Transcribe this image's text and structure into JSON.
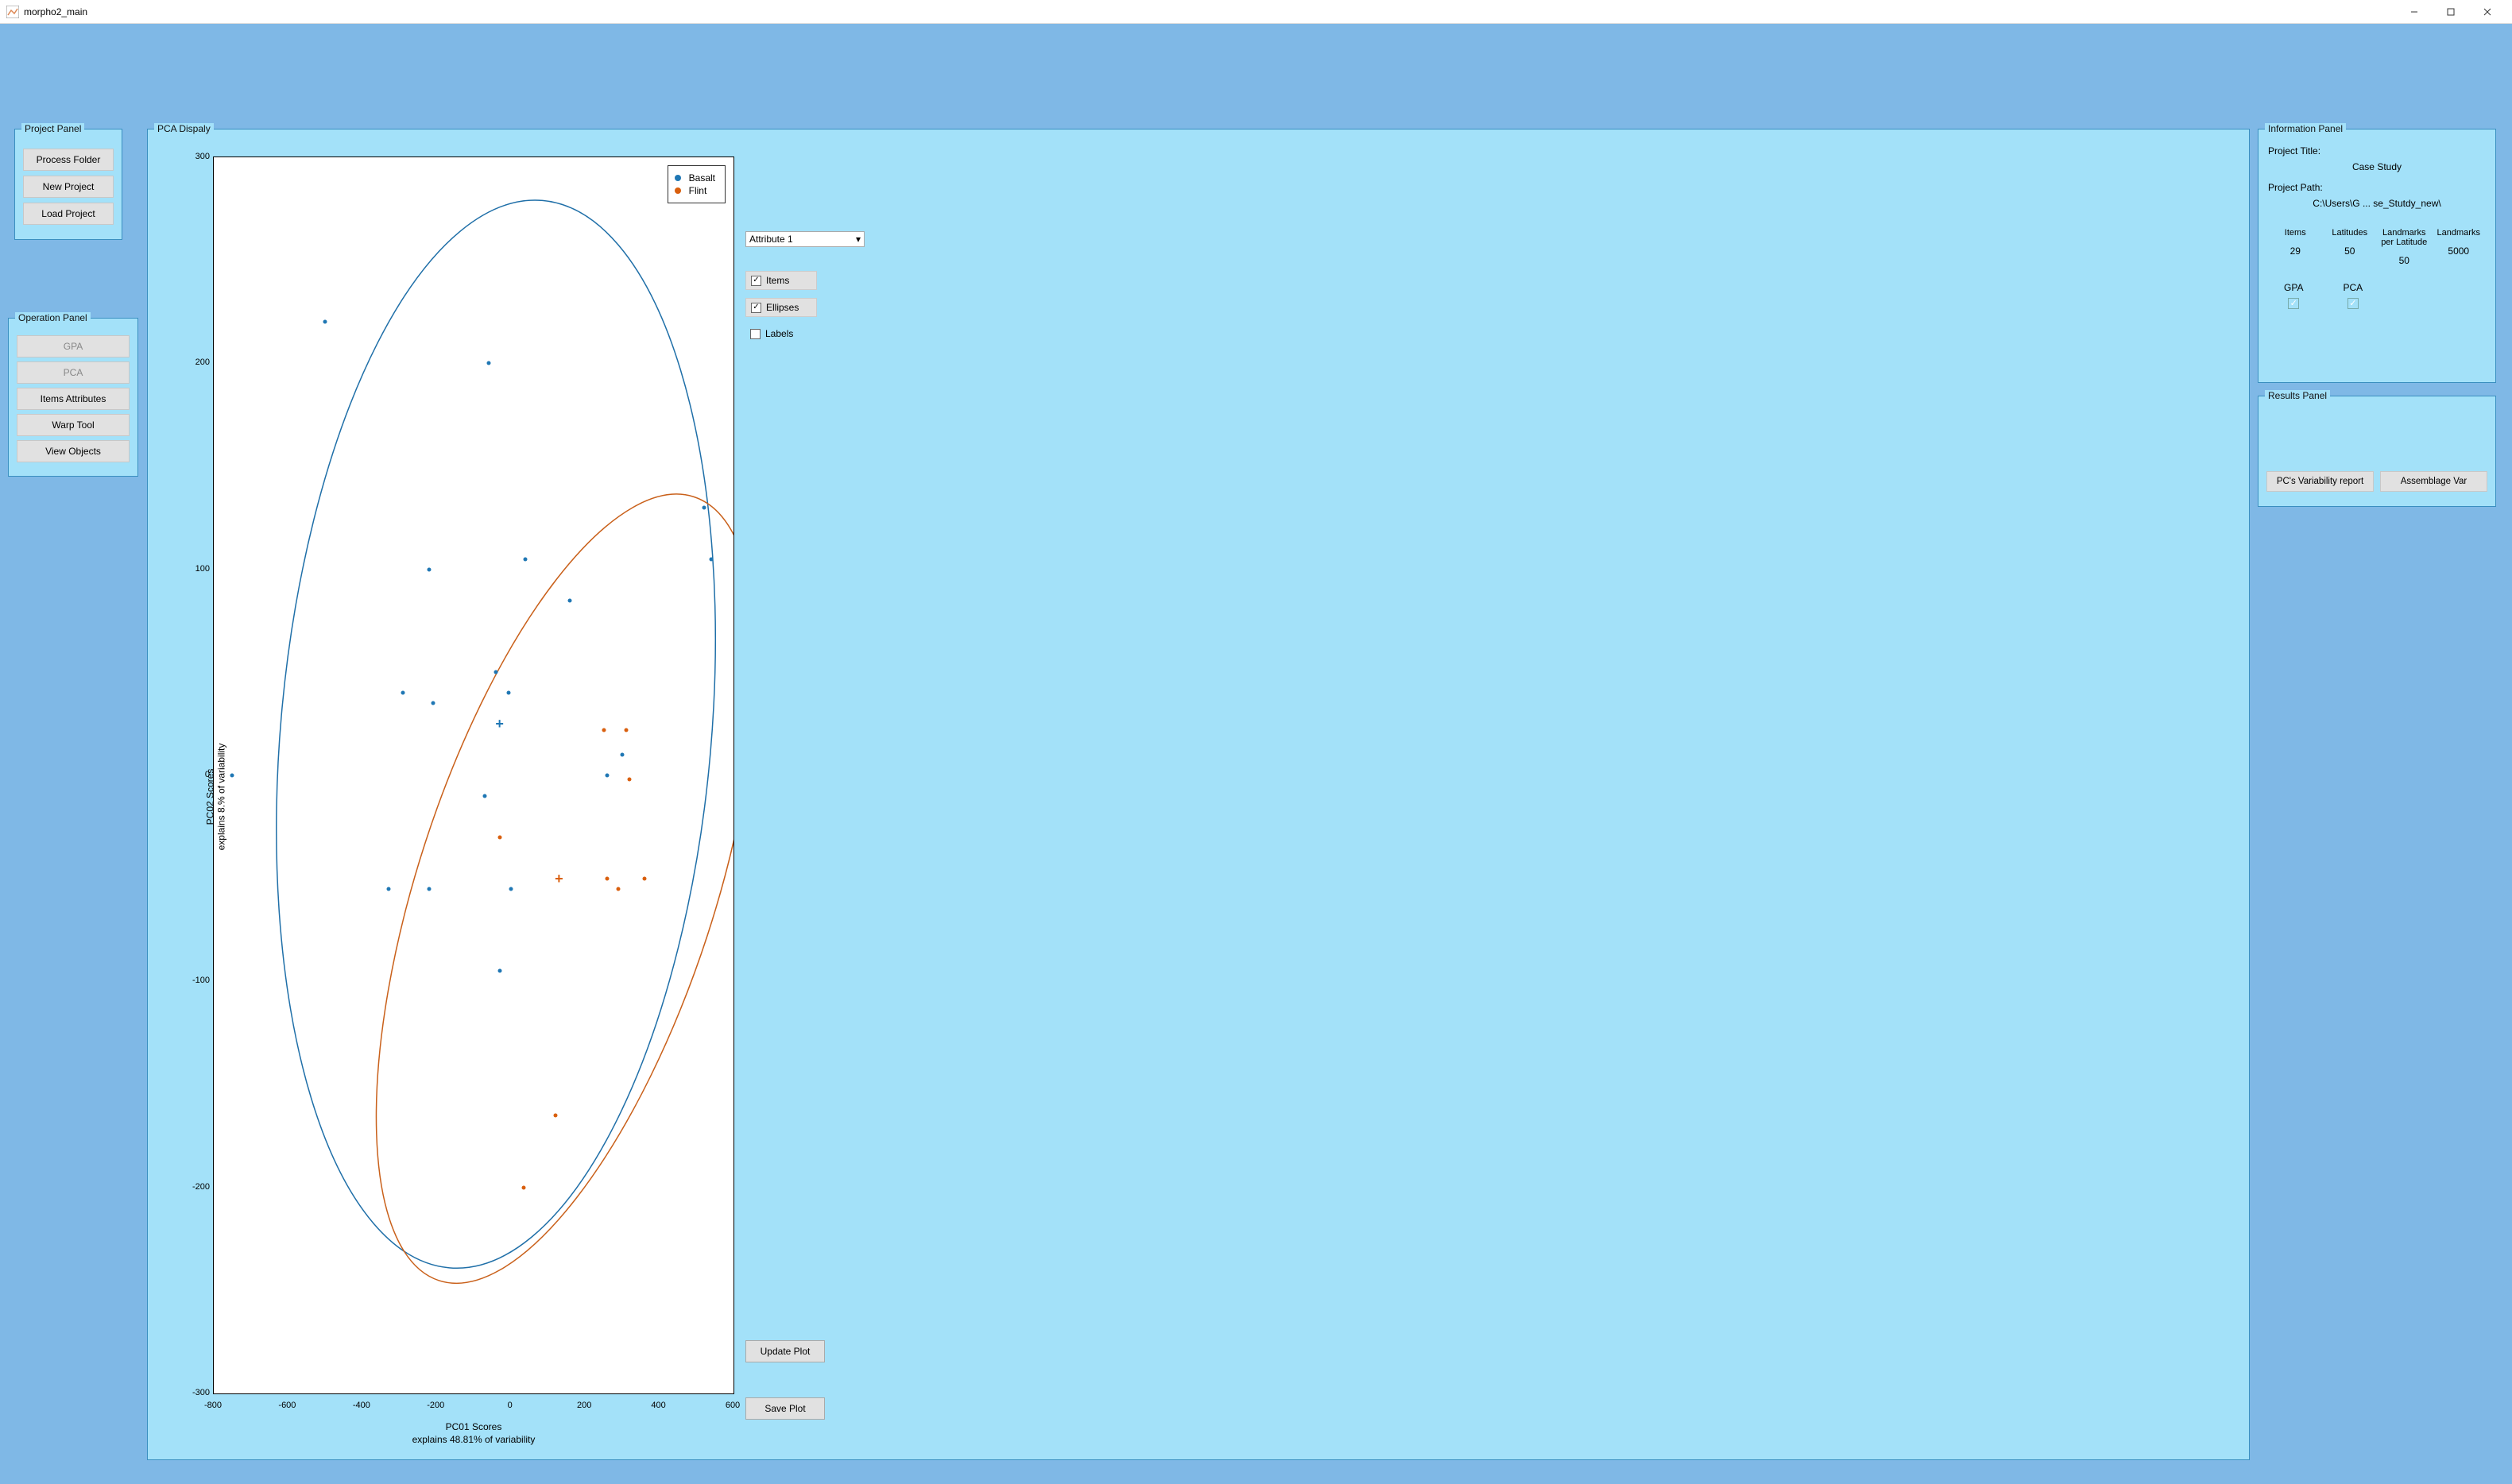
{
  "window": {
    "title": "morpho2_main"
  },
  "project_panel": {
    "legend": "Project Panel",
    "buttons": {
      "process_folder": "Process Folder",
      "new_project": "New Project",
      "load_project": "Load Project"
    }
  },
  "operation_panel": {
    "legend": "Operation Panel",
    "buttons": {
      "gpa": "GPA",
      "pca": "PCA",
      "items_attributes": "Items Attributes",
      "warp_tool": "Warp Tool",
      "view_objects": "View Objects"
    }
  },
  "pca_display": {
    "legend": "PCA Dispaly",
    "x_label_line1": "PC01 Scores",
    "x_label_line2": "explains 48.81% of variability",
    "y_label_line1": "PC02 Scores",
    "y_label_line2": "explains 8.% of variability",
    "legend_items": {
      "basalt": "Basalt",
      "flint": "Flint"
    },
    "dropdown": "Attribute 1",
    "checkboxes": {
      "items": "Items",
      "ellipses": "Ellipses",
      "labels": "Labels"
    },
    "update_btn": "Update Plot",
    "save_btn": "Save Plot"
  },
  "info_panel": {
    "legend": "Information Panel",
    "project_title_label": "Project Title:",
    "project_title_value": "Case Study",
    "project_path_label": "Project Path:",
    "project_path_value": "C:\\Users\\G ... se_Stutdy_new\\",
    "cols": {
      "items_hdr": "Items",
      "items_val": "29",
      "latitudes_hdr": "Latitudes",
      "latitudes_val": "50",
      "lpl_hdr": "Landmarks per Latitude",
      "lpl_val": "50",
      "landmarks_hdr": "Landmarks",
      "landmarks_val": "5000"
    },
    "gpa_label": "GPA",
    "pca_label": "PCA"
  },
  "results_panel": {
    "legend": "Results Panel",
    "pcs_btn": "PC's Variability report",
    "assemblage_btn": "Assemblage Var"
  },
  "chart_data": {
    "type": "scatter",
    "title": "",
    "xlabel": "PC01 Scores — explains 48.81% of variability",
    "ylabel": "PC02 Scores — explains 8.% of variability",
    "xlim": [
      -800,
      600
    ],
    "ylim": [
      -300,
      300
    ],
    "x_ticks": [
      -800,
      -600,
      -400,
      -200,
      0,
      200,
      400,
      600
    ],
    "y_ticks": [
      -300,
      -200,
      -100,
      0,
      100,
      200,
      300
    ],
    "series": [
      {
        "name": "Basalt",
        "color": "#1f77b4",
        "points": [
          [
            -500,
            220
          ],
          [
            -60,
            200
          ],
          [
            520,
            130
          ],
          [
            -220,
            100
          ],
          [
            540,
            105
          ],
          [
            -290,
            40
          ],
          [
            -210,
            35
          ],
          [
            -40,
            50
          ],
          [
            -5,
            40
          ],
          [
            40,
            105
          ],
          [
            160,
            85
          ],
          [
            -70,
            -10
          ],
          [
            260,
            0
          ],
          [
            300,
            10
          ],
          [
            -330,
            -55
          ],
          [
            -220,
            -55
          ],
          [
            0,
            -55
          ],
          [
            -30,
            -95
          ],
          [
            -750,
            0
          ]
        ],
        "centroid": [
          -30,
          25
        ]
      },
      {
        "name": "Flint",
        "color": "#d95f0e",
        "points": [
          [
            250,
            22
          ],
          [
            310,
            22
          ],
          [
            320,
            -2
          ],
          [
            -30,
            -30
          ],
          [
            260,
            -50
          ],
          [
            290,
            -55
          ],
          [
            360,
            -50
          ],
          [
            120,
            -165
          ],
          [
            35,
            -200
          ]
        ],
        "centroid": [
          130,
          -50
        ]
      }
    ],
    "ellipses": [
      {
        "name": "Basalt",
        "color": "#1f6fa8",
        "cx": -40,
        "cy": 20,
        "rx": 580,
        "ry": 260,
        "rotation_deg": -5
      },
      {
        "name": "Flint",
        "color": "#c9601a",
        "cx": 150,
        "cy": -55,
        "rx": 400,
        "ry": 200,
        "rotation_deg": -18
      }
    ]
  }
}
